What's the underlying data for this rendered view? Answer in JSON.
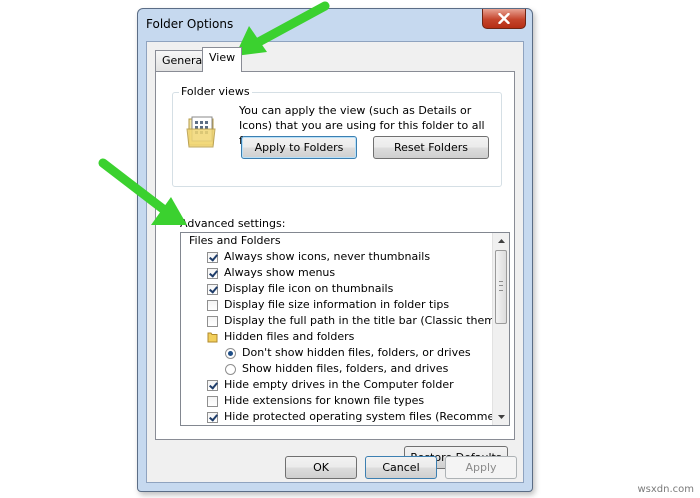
{
  "window": {
    "title": "Folder Options"
  },
  "tabs": [
    {
      "label": "General"
    },
    {
      "label": "View"
    }
  ],
  "folder_views": {
    "label": "Folder views",
    "description": "You can apply the view (such as Details or Icons) that you are using for this folder to all folders of this type.",
    "apply_button": "Apply to Folders",
    "reset_button": "Reset Folders"
  },
  "advanced": {
    "label": "Advanced settings:",
    "items": [
      {
        "kind": "root",
        "label": "Files and Folders"
      },
      {
        "kind": "checkbox",
        "checked": true,
        "label": "Always show icons, never thumbnails"
      },
      {
        "kind": "checkbox",
        "checked": true,
        "label": "Always show menus"
      },
      {
        "kind": "checkbox",
        "checked": true,
        "label": "Display file icon on thumbnails"
      },
      {
        "kind": "checkbox",
        "checked": false,
        "label": "Display file size information in folder tips"
      },
      {
        "kind": "checkbox",
        "checked": false,
        "label": "Display the full path in the title bar (Classic theme only)"
      },
      {
        "kind": "folder",
        "label": "Hidden files and folders"
      },
      {
        "kind": "radio",
        "selected": true,
        "label": "Don't show hidden files, folders, or drives"
      },
      {
        "kind": "radio",
        "selected": false,
        "label": "Show hidden files, folders, and drives"
      },
      {
        "kind": "checkbox",
        "checked": true,
        "label": "Hide empty drives in the Computer folder"
      },
      {
        "kind": "checkbox",
        "checked": false,
        "label": "Hide extensions for known file types"
      },
      {
        "kind": "checkbox",
        "checked": true,
        "label": "Hide protected operating system files (Recommended)"
      }
    ]
  },
  "buttons": {
    "restore": "Restore Defaults",
    "ok": "OK",
    "cancel": "Cancel",
    "apply": "Apply"
  },
  "watermark": "wsxdn.com",
  "colors": {
    "arrow": "#3bd12f",
    "frame": "#c6d9ef",
    "close": "#c5452c"
  },
  "icons": {
    "close": "close-x-icon",
    "folder_views": "folder-view-icon",
    "hidden_folder": "folder-icon",
    "scroll_up": "chevron-up-icon",
    "scroll_down": "chevron-down-icon",
    "annotation": "green-arrow-icon"
  }
}
